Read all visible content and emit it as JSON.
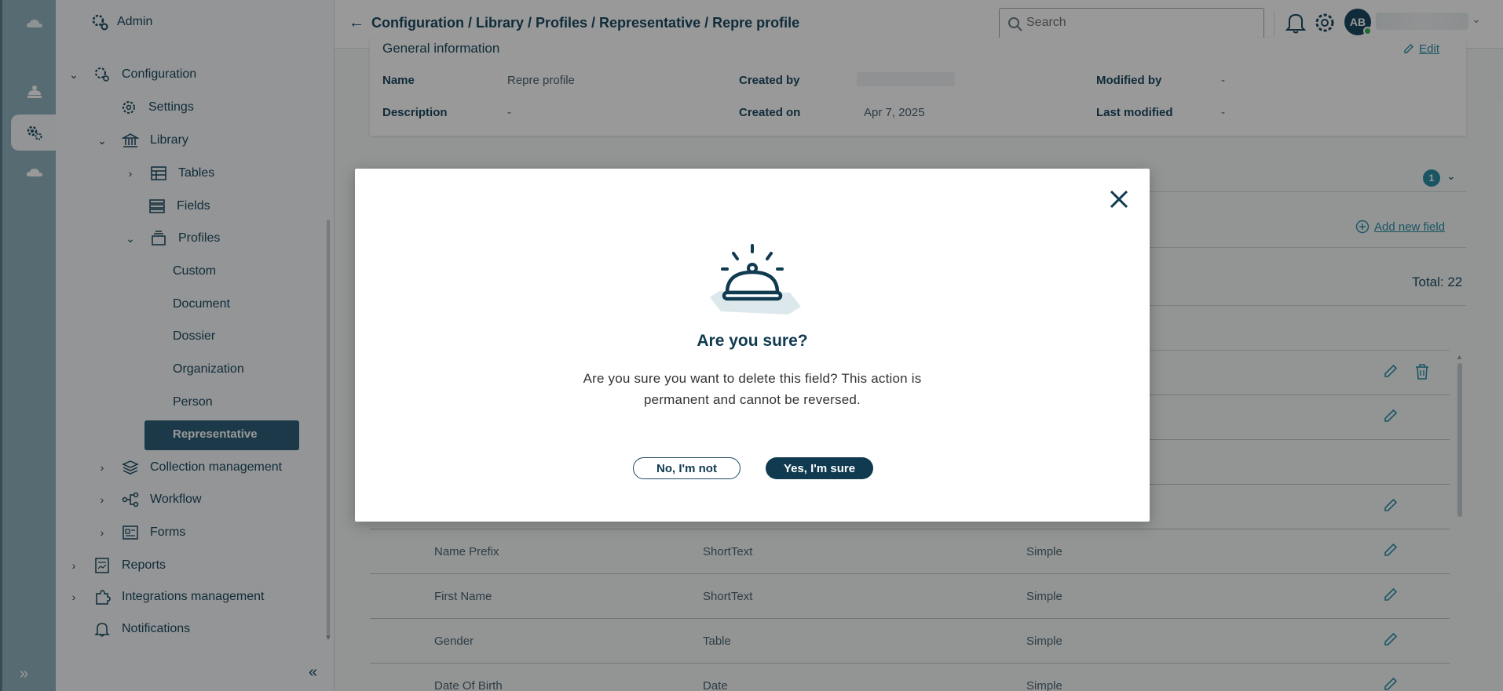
{
  "sidebar": {
    "header": "Admin",
    "items": [
      {
        "label": "Configuration"
      },
      {
        "label": "Settings"
      },
      {
        "label": "Library"
      },
      {
        "label": "Tables"
      },
      {
        "label": "Fields"
      },
      {
        "label": "Profiles"
      },
      {
        "label": "Custom"
      },
      {
        "label": "Document"
      },
      {
        "label": "Dossier"
      },
      {
        "label": "Organization"
      },
      {
        "label": "Person"
      },
      {
        "label": "Representative"
      },
      {
        "label": "Collection management"
      },
      {
        "label": "Workflow"
      },
      {
        "label": "Forms"
      },
      {
        "label": "Reports"
      },
      {
        "label": "Integrations management"
      },
      {
        "label": "Notifications"
      }
    ],
    "active_item": "Representative"
  },
  "header": {
    "breadcrumb": "Configuration / Library / Profiles / Representative / Repre profile",
    "search_placeholder": "Search",
    "avatar_initials": "AB"
  },
  "general_info": {
    "title": "General information",
    "edit_label": "Edit",
    "fields": {
      "name_label": "Name",
      "name_value": "Repre profile",
      "description_label": "Description",
      "description_value": "-",
      "created_by_label": "Created by",
      "created_on_label": "Created on",
      "created_on_value": "Apr 7, 2025",
      "modified_by_label": "Modified by",
      "modified_by_value": "-",
      "last_modified_label": "Last modified",
      "last_modified_value": "-"
    }
  },
  "fields_section": {
    "badge_count": "1",
    "add_new_field": "Add new field",
    "total": "Total: 22",
    "rows": [
      {
        "name": "Name Prefix",
        "type": "ShortText",
        "kind": "Simple"
      },
      {
        "name": "First Name",
        "type": "ShortText",
        "kind": "Simple"
      },
      {
        "name": "Gender",
        "type": "Table",
        "kind": "Simple"
      },
      {
        "name": "Date Of Birth",
        "type": "Date",
        "kind": "Simple"
      }
    ]
  },
  "modal": {
    "title": "Are you sure?",
    "message": "Are you sure you want to delete this field? This action is permanent and cannot be reversed.",
    "cancel_label": "No, I'm not",
    "confirm_label": "Yes, I'm sure"
  },
  "colors": {
    "brand_dark": "#0f3a50",
    "accent": "#2a8ea6",
    "active_nav": "#2d5f79",
    "rail": "#8fb2bf"
  }
}
